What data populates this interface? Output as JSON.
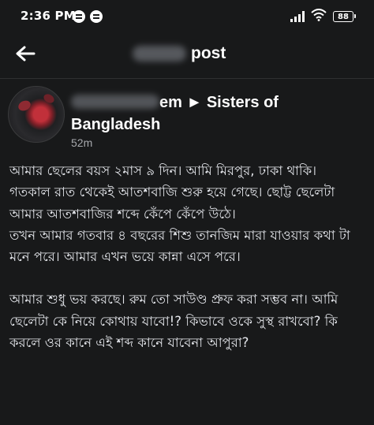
{
  "status_bar": {
    "time": "2:36 PM",
    "battery": "88",
    "icons": [
      "notification-icon",
      "notification-icon",
      "signal-icon",
      "wifi-icon",
      "battery-icon"
    ]
  },
  "app_bar": {
    "title": "post",
    "back_icon": "arrow-left-icon"
  },
  "post": {
    "author_suffix": "em ► Sisters of Bangladesh",
    "time": "52m",
    "paragraphs": [
      "আমার ছেলের বয়স ২মাস ৯ দিন। আমি মিরপুর, ঢাকা থাকি।",
      "গতকাল রাত থেকেই আতশবাজি শুরু হয়ে গেছে। ছোট্ট ছেলেটা আমার আতশবাজির শব্দে কেঁপে কেঁপে উঠে।",
      "তখন আমার গতবার ৪ বছরের শিশু তানজিম মারা যাওয়ার কথা টা মনে পরে। আমার এখন ভয়ে কান্না এসে পরে।",
      "আমার শুধু ভয় করছে। রুম তো সাউণ্ড প্রুফ করা সম্ভব না। আমি ছেলেটা কে নিয়ে কোথায় যাবো!? কিভাবে ওকে সুস্থ রাখবো? কি করলে ওর কানে এই শব্দ কানে যাবেনা আপুরা?"
    ]
  },
  "colors": {
    "background": "#18191a",
    "text": "#e4e6eb",
    "secondary_text": "#a7a9ad"
  }
}
